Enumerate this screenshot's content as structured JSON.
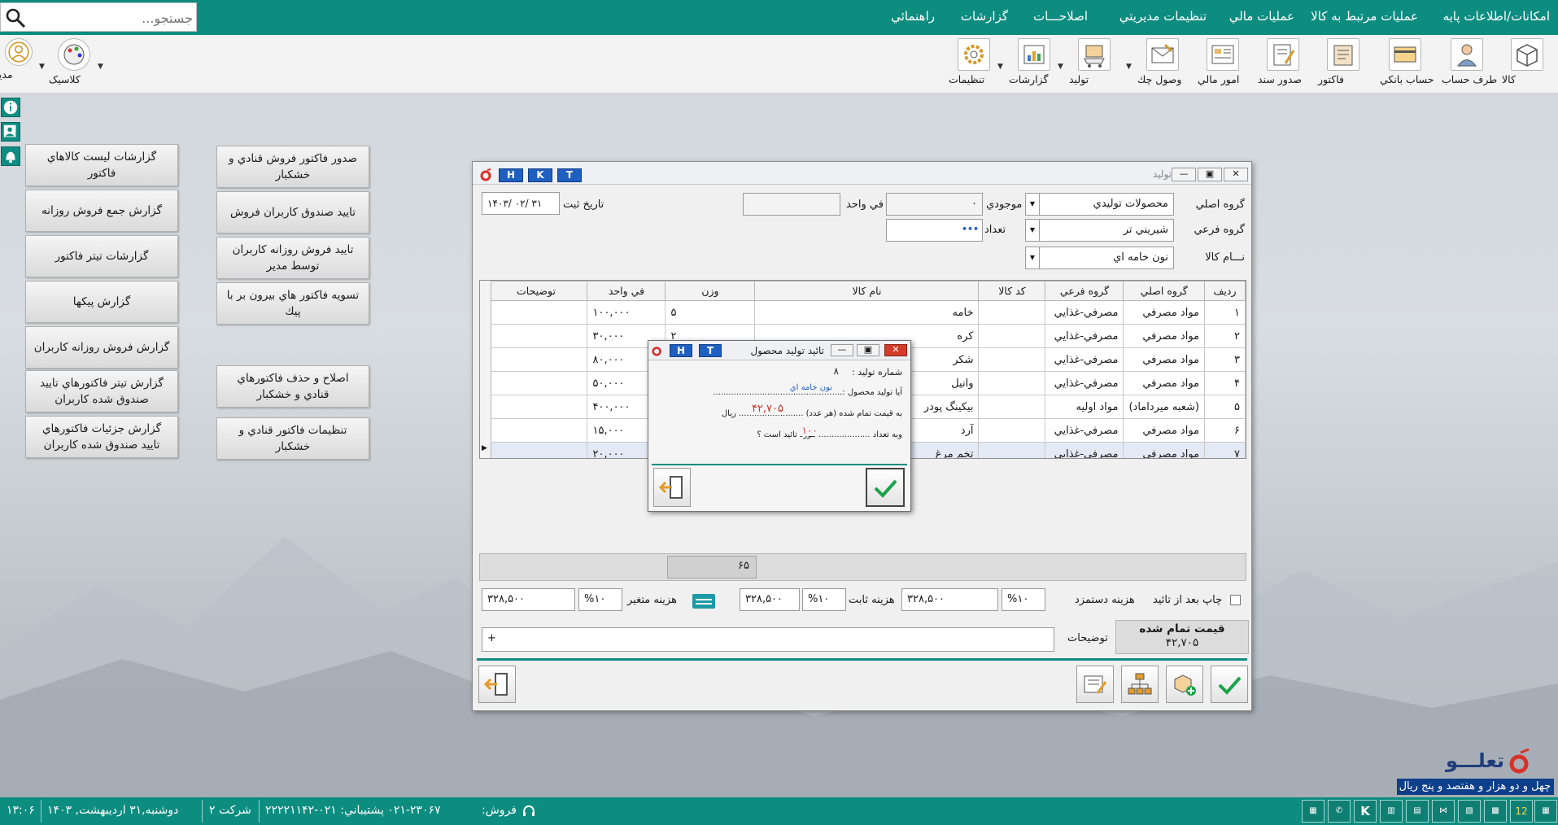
{
  "top_menu": {
    "items": [
      "امکانات/اطلاعات پایه",
      "عمليات مرتبط به کالا",
      "عمليات مالي",
      "تنظيمات مديريتي",
      "اصلاحـــات",
      "گزارشات",
      "راهنمائي"
    ],
    "search_placeholder": "جستجو..."
  },
  "toolbar": {
    "right": [
      "کالا",
      "طرف حساب",
      "حساب بانکي",
      "فاکتور",
      "صدور سند",
      "امور مالي",
      "وصول چك",
      "توليد",
      "گزارشات",
      "تنظيمات"
    ],
    "left": [
      "کلاسيک",
      "مدير"
    ]
  },
  "left_panel": {
    "col1": [
      "گزارشات ليست کالاهاي فاکتور",
      "گزارش جمع فروش روزانه",
      "گزارشات تيتر فاکتور",
      "گزارش پيکها",
      "گزارش فروش روزانه کاربران",
      "گزارش تيتر فاکتورهاي تاييد صندوق شده کاربران",
      "گزارش جزئيات فاکتورهاي تاييد صندوق شده کاربران"
    ],
    "col2": [
      "صدور فاکتور فروش قنادي و خشکبار",
      "تاييد صندوق کاربران فروش",
      "تاييد فروش روزانه کاربران توسط مدير",
      "تسويه فاکتور هاي بيرون بر با پيك",
      "اصلاح و حذف فاکتورهاي قنادي و خشکبار",
      "تنظيمات فاکتور قنادي و خشکبار"
    ]
  },
  "production": {
    "title": "توليد",
    "hkt": [
      "H",
      "K",
      "T"
    ],
    "labels": {
      "group_main": "گروه اصلي",
      "group_sub": "گروه فرعي",
      "product_name": "نـــام کالا",
      "stock": "موجودي",
      "qty": "تعداد",
      "unit_price": "في واحد",
      "date": "تاريخ ثبت"
    },
    "values": {
      "group_main": "محصولات توليدي",
      "group_sub": "شيريني تر",
      "product_name": "نون خامه اي",
      "stock": "۰",
      "qty": "۱۰۰",
      "unit_price": "",
      "date": "۱۴۰۳/ ۰۲/ ۳۱"
    },
    "table": {
      "headers": [
        "رديف",
        "گروه اصلي",
        "گروه فرعي",
        "کد کالا",
        "نام کالا",
        "وزن",
        "في واحد",
        "توضيحات"
      ],
      "rows": [
        [
          "۱",
          "مواد مصرفي",
          "مصرفي-غذايي",
          "",
          "خامه",
          "۵",
          "۱۰۰,۰۰۰",
          ""
        ],
        [
          "۲",
          "مواد مصرفي",
          "مصرفي-غذايي",
          "",
          "کره",
          "۲",
          "۳۰,۰۰۰",
          ""
        ],
        [
          "۳",
          "مواد مصرفي",
          "مصرفي-غذايي",
          "",
          "شکر",
          "",
          "۸۰,۰۰۰",
          ""
        ],
        [
          "۴",
          "مواد مصرفي",
          "مصرفي-غذايي",
          "",
          "وانيل",
          "",
          "۵۰,۰۰۰",
          ""
        ],
        [
          "۵",
          "(شعبه ميرداماد)",
          "مواد اوليه",
          "",
          "بيکينگ پودر",
          "",
          "۴۰۰,۰۰۰",
          ""
        ],
        [
          "۶",
          "مواد مصرفي",
          "مصرفي-غذايي",
          "",
          "آرد",
          "",
          "۱۵,۰۰۰",
          ""
        ],
        [
          "۷",
          "مواد مصرفي",
          "مصرفي-غذايي",
          "",
          "تخم مرغ",
          "",
          "۲۰,۰۰۰",
          ""
        ]
      ]
    },
    "sum_weight": "۶۵",
    "print_after": "چاپ بعد از تائيد",
    "labor": {
      "label": "هزينه دستمزد",
      "pct": "۱۰",
      "value": "۳۲۸,۵۰۰"
    },
    "fixed": {
      "label": "هزينه ثابت",
      "pct": "۱۰",
      "value": "۳۲۸,۵۰۰"
    },
    "variable": {
      "label": "هزينه متغير",
      "pct": "۱۰",
      "value": "۳۲۸,۵۰۰"
    },
    "pct_sign": "%",
    "final_price_label": "قيمت تمام شده",
    "final_price": "۴۲,۷۰۵",
    "desc_label": "توضيحات",
    "desc_value": "+"
  },
  "dialog": {
    "title": "تائيد توليد محصول",
    "hkt": [
      "H",
      "T"
    ],
    "prod_no_label": "شماره توليد :",
    "prod_no": "۸",
    "q1": "آيا توليد محصول :..................................................",
    "product": "نون خامه اي",
    "q2": "به قيمت تمام شده (هر عدد) ......................... ريال",
    "price": "۴۲,۷۰۵",
    "q3": "وبه تعداد .................... مورد تائيد است ؟",
    "qty": "۱۰۰"
  },
  "status": {
    "time": "۱۳:۰۶",
    "date": "دوشنبه,۳۱ ارديبهشت, ۱۴۰۳",
    "company": "شرکت ۲",
    "support": "۰۲۱-۲۳۰۶۷ پشتيباني: ۰۲۱-۲۲۲۲۱۱۴۲",
    "sales": "فروش:",
    "sum_text": "چهل و دو هزار  و هفتصد و پنج ريال",
    "quick": [
      "12",
      "K"
    ]
  },
  "logo_text": "تعلـــو",
  "colors": {
    "teal": "#0d8c80",
    "blue": "#1f5fbf",
    "red": "#c0392b",
    "check": "#1aa34a"
  }
}
